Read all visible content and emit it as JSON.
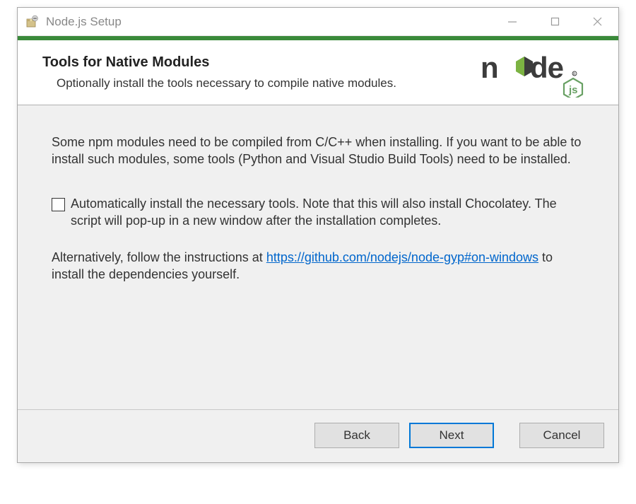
{
  "window": {
    "title": "Node.js Setup"
  },
  "header": {
    "title": "Tools for Native Modules",
    "subtitle": "Optionally install the tools necessary to compile native modules.",
    "logo_text": "node"
  },
  "body": {
    "paragraph1": "Some npm modules need to be compiled from C/C++ when installing. If you want to be able to install such modules, some tools (Python and Visual Studio Build Tools) need to be installed.",
    "checkbox_label": "Automatically install the necessary tools. Note that this will also install Chocolatey. The script will pop-up in a new window after the installation completes.",
    "checkbox_checked": false,
    "alt_prefix": "Alternatively, follow the instructions at ",
    "alt_link_text": "https://github.com/nodejs/node-gyp#on-windows",
    "alt_suffix": " to install the dependencies yourself."
  },
  "footer": {
    "back": "Back",
    "next": "Next",
    "cancel": "Cancel"
  },
  "colors": {
    "accent_green": "#3a8a3a",
    "link_blue": "#0066cc",
    "primary_border": "#0078d7"
  }
}
